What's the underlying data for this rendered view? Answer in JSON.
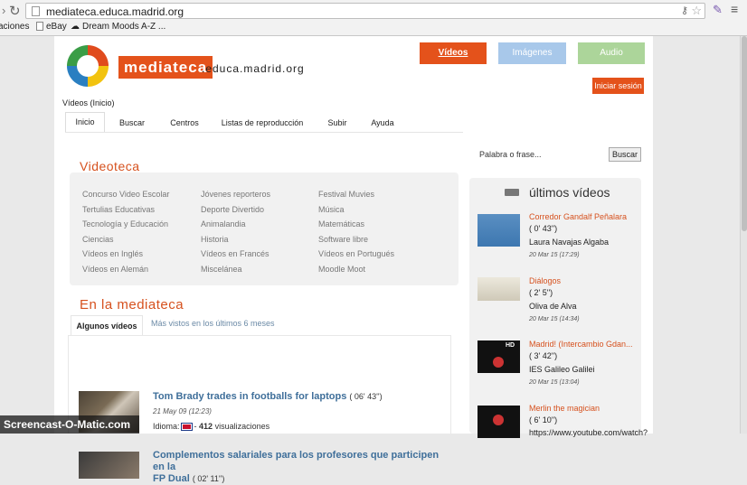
{
  "browser": {
    "url": "mediateca.educa.madrid.org",
    "bookmarks": [
      "aciones",
      "eBay",
      "Dream Moods A-Z ..."
    ]
  },
  "header": {
    "brand": "mediateca",
    "domain": ".educa.madrid.org",
    "tabs": {
      "videos": "Vídeos",
      "images": "Imágenes",
      "audio": "Audio"
    },
    "login": "Iniciar sesión",
    "breadcrumb": "Vídeos (Inicio)"
  },
  "nav": [
    "Inicio",
    "Buscar",
    "Centros",
    "Listas de reproducción",
    "Subir",
    "Ayuda"
  ],
  "search": {
    "placeholder": "Palabra o frase...",
    "button": "Buscar"
  },
  "videoteca": {
    "title": "Videoteca",
    "columns": [
      [
        "Concurso Video Escolar",
        "Tertulias Educativas",
        "Tecnología y Educación",
        "Ciencias",
        "Vídeos en Inglés",
        "Vídeos en Alemán"
      ],
      [
        "Jóvenes reporteros",
        "Deporte Divertido",
        "Animalandia",
        "Historia",
        "Vídeos en Francés",
        "Miscelánea"
      ],
      [
        "Festival Muvies",
        "Música",
        "Matemáticas",
        "Software libre",
        "Vídeos en Portugués",
        "Moodle Moot"
      ]
    ]
  },
  "mediateca": {
    "title": "En la mediateca",
    "tab_active": "Algunos vídeos",
    "tab_other": "Más vistos en los últimos 6 meses",
    "videos": [
      {
        "title": "Tom Brady trades in footballs for laptops",
        "duration": "( 06' 43'')",
        "date": "21 May 09 (12:23)",
        "lang_label": "Idioma:",
        "views_count": "412",
        "views_label": "visualizaciones"
      },
      {
        "title1": "Complementos salariales para los profesores que participen en la",
        "title2": "FP Dual",
        "duration": "( 02' 11'')"
      }
    ]
  },
  "latest": {
    "title": "últimos vídeos",
    "items": [
      {
        "title": "Corredor Gandalf Peñalara",
        "duration": "( 0' 43'')",
        "author": "Laura Navajas Algaba",
        "date": "20 Mar 15 (17:29)"
      },
      {
        "title": "Diálogos",
        "duration": "( 2' 5'')",
        "author": "Oliva de Alva",
        "date": "20 Mar 15 (14:34)"
      },
      {
        "title": "Madrid! (Intercambio Gdan...",
        "duration": "( 3' 42'')",
        "author": "IES Galileo Galilei",
        "date": "20 Mar 15 (13:04)"
      },
      {
        "title": "Merlin the magician",
        "duration": "( 6' 10'')",
        "author": "https://www.youtube.com/watch?"
      }
    ]
  },
  "watermark": "Screencast-O-Matic.com"
}
